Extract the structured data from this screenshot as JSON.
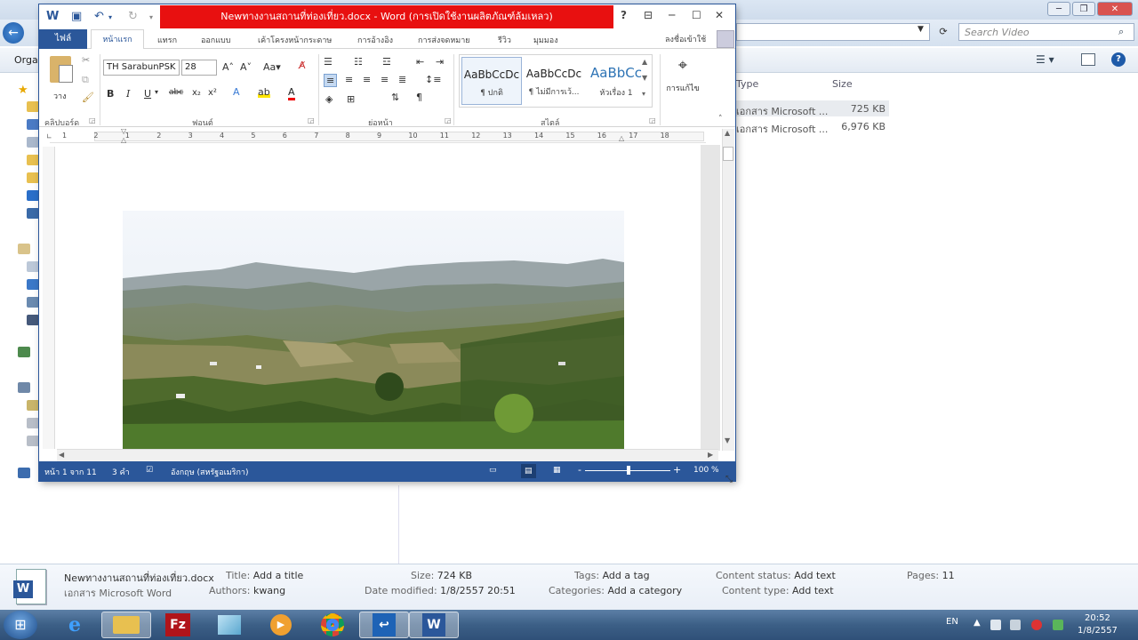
{
  "explorer": {
    "organize_label": "Organ",
    "search_placeholder": "Search Video",
    "columns": {
      "type": "Type",
      "size": "Size"
    },
    "files": [
      {
        "type": "เอกสาร Microsoft ...",
        "size": "725 KB"
      },
      {
        "type": "เอกสาร Microsoft ...",
        "size": "6,976 KB"
      }
    ],
    "details": {
      "file_name": "Newทางงานสถานที่ท่องเที่ยว.docx",
      "file_type": "เอกสาร Microsoft Word",
      "title_label": "Title:",
      "title_value": "Add a title",
      "authors_label": "Authors:",
      "authors_value": "kwang",
      "size_label": "Size:",
      "size_value": "724 KB",
      "modified_label": "Date modified:",
      "modified_value": "1/8/2557 20:51",
      "tags_label": "Tags:",
      "tags_value": "Add a tag",
      "categories_label": "Categories:",
      "categories_value": "Add a category",
      "content_status_label": "Content status:",
      "content_status_value": "Add text",
      "content_type_label": "Content type:",
      "content_type_value": "Add text",
      "pages_label": "Pages:",
      "pages_value": "11"
    }
  },
  "word": {
    "title": "Newทางงานสถานที่ท่องเที่ยว.docx - Word (การเปิดใช้งานผลิตภัณฑ์ล้มเหลว)",
    "help": "?",
    "tabs": [
      "ไฟล์",
      "หน้าแรก",
      "แทรก",
      "ออกแบบ",
      "เค้าโครงหน้ากระดาษ",
      "การอ้างอิง",
      "การส่งจดหมาย",
      "รีวิว",
      "มุมมอง"
    ],
    "signin": "ลงชื่อเข้าใช้",
    "font_name": "TH SarabunPSK",
    "font_size": "28",
    "groups": {
      "clipboard": "คลิปบอร์ด",
      "font": "ฟอนต์",
      "paragraph": "ย่อหน้า",
      "styles": "สไตล์",
      "editing": "การแก้ไข"
    },
    "paste_label": "วาง",
    "styles": [
      {
        "preview": "AaBbCcDc",
        "name": "¶ ปกติ"
      },
      {
        "preview": "AaBbCcDc",
        "name": "¶ ไม่มีการเว้..."
      },
      {
        "preview": "AaBbCc",
        "name": "หัวเรื่อง 1"
      }
    ],
    "ruler_numbers": [
      "1",
      "2",
      "1",
      "2",
      "3",
      "4",
      "5",
      "6",
      "7",
      "8",
      "9",
      "10",
      "11",
      "12",
      "13",
      "14",
      "15",
      "16",
      "17",
      "18"
    ],
    "status": {
      "page": "หน้า 1 จาก 11",
      "words": "3 คำ",
      "language": "อังกฤษ (สหรัฐอเมริกา)",
      "zoom": "100 %",
      "zoom_minus": "-",
      "zoom_plus": "+"
    }
  },
  "taskbar": {
    "language": "EN",
    "time": "20:52",
    "date": "1/8/2557"
  }
}
